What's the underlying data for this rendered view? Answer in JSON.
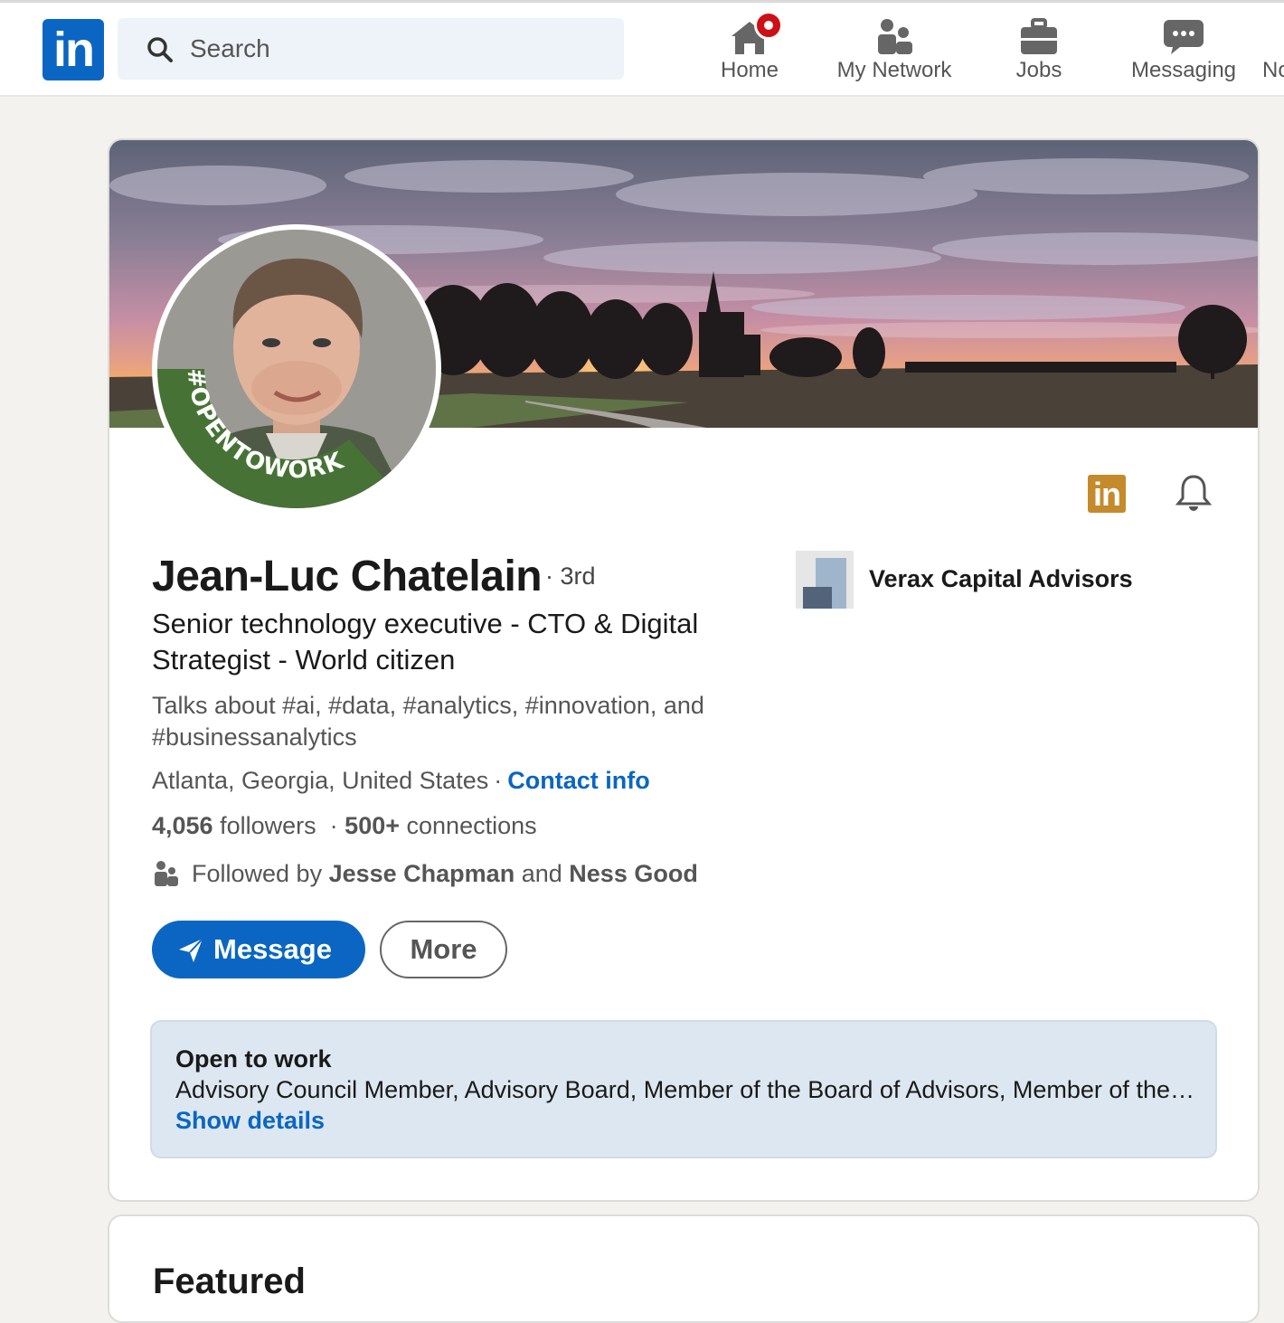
{
  "nav": {
    "search_placeholder": "Search",
    "items": [
      {
        "label": "Home",
        "icon": "home-icon",
        "notification": true
      },
      {
        "label": "My Network",
        "icon": "my-network-icon"
      },
      {
        "label": "Jobs",
        "icon": "briefcase-icon"
      },
      {
        "label": "Messaging",
        "icon": "messaging-icon"
      },
      {
        "label": "No",
        "icon": "notifications-icon"
      }
    ],
    "brand_color": "#0a66c2",
    "badge_color": "#cc1016"
  },
  "profile": {
    "badge_text": "#OPENTOWORK",
    "badge_color": "#4f7f3a",
    "name": "Jean-Luc Chatelain",
    "degree": "· 3rd",
    "headline": "Senior technology executive - CTO & Digital Strategist - World citizen",
    "talks_about": "Talks about #ai, #data, #analytics, #innovation, and #businessanalytics",
    "location": "Atlanta, Georgia, United States",
    "location_sep": "·",
    "contact_info": "Contact info",
    "followers_count": "4,056",
    "followers_label": "followers",
    "stats_sep": "·",
    "connections_count": "500+",
    "connections_label": "connections",
    "followed_by_prefix": "Followed by",
    "followed_by_1": "Jesse Chapman",
    "followed_by_and": "and",
    "followed_by_2": "Ness Good",
    "company": "Verax Capital Advisors",
    "actions": {
      "message": "Message",
      "more": "More"
    },
    "premium_icon_text": "in"
  },
  "open_to_work": {
    "title": "Open to work",
    "roles": "Advisory Council Member, Advisory Board, Member of the Board of Advisors, Member of the Advisory Council",
    "show_details": "Show details"
  },
  "next_section": {
    "title": "Featured"
  }
}
